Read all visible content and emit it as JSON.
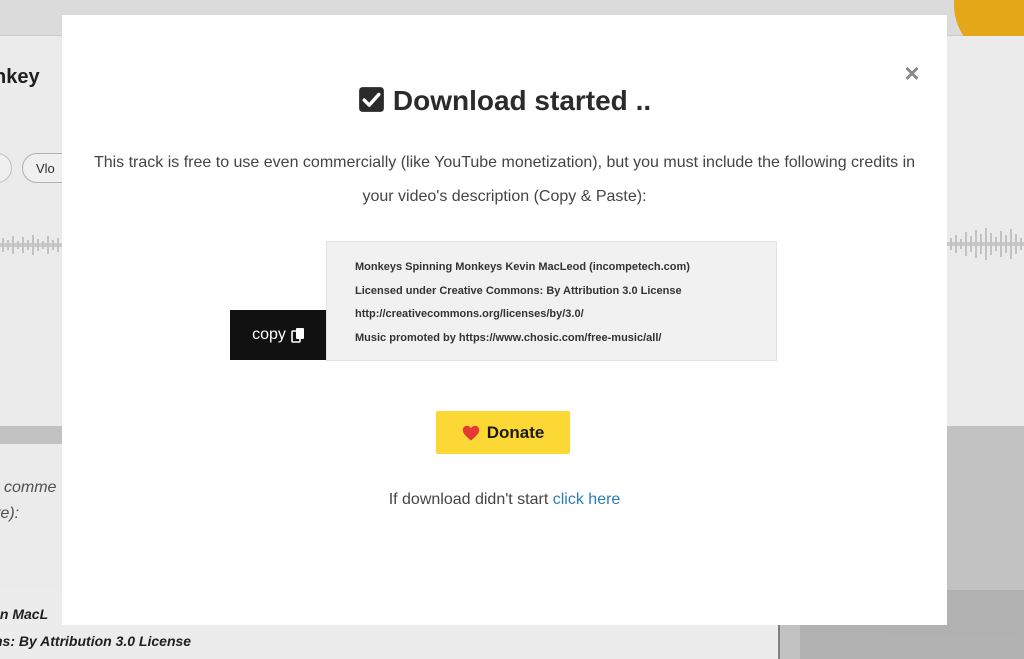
{
  "background": {
    "title_fragment": "nkey",
    "subtitle_fragment": ")",
    "chip_label": "Vlo",
    "italic_fragment_1": "comme",
    "italic_fragment_2": "te):",
    "credit_fragment_1": "in MacL",
    "credit_fragment_2": "ns: By Attribution 3.0 License",
    "accent_color": "#f3b21a"
  },
  "modal": {
    "close_label": "×",
    "title": "Download started ..",
    "title_icon": "checkbox-checked-icon",
    "description": "This track is free to use even commercially (like YouTube monetization), but you must include the following credits in your video's description (Copy & Paste):",
    "copy_button": {
      "label": "copy",
      "icon": "copy-icon"
    },
    "credits": [
      "Monkeys Spinning Monkeys Kevin MacLeod (incompetech.com)",
      "Licensed under Creative Commons: By Attribution 3.0 License",
      "http://creativecommons.org/licenses/by/3.0/",
      "Music promoted by https://www.chosic.com/free-music/all/"
    ],
    "donate": {
      "label": "Donate",
      "icon": "heart-icon",
      "color": "#fbd833",
      "icon_color": "#e53935"
    },
    "fallback_text": "If download didn't start",
    "fallback_link": "click here",
    "link_color": "#2a7db8"
  }
}
